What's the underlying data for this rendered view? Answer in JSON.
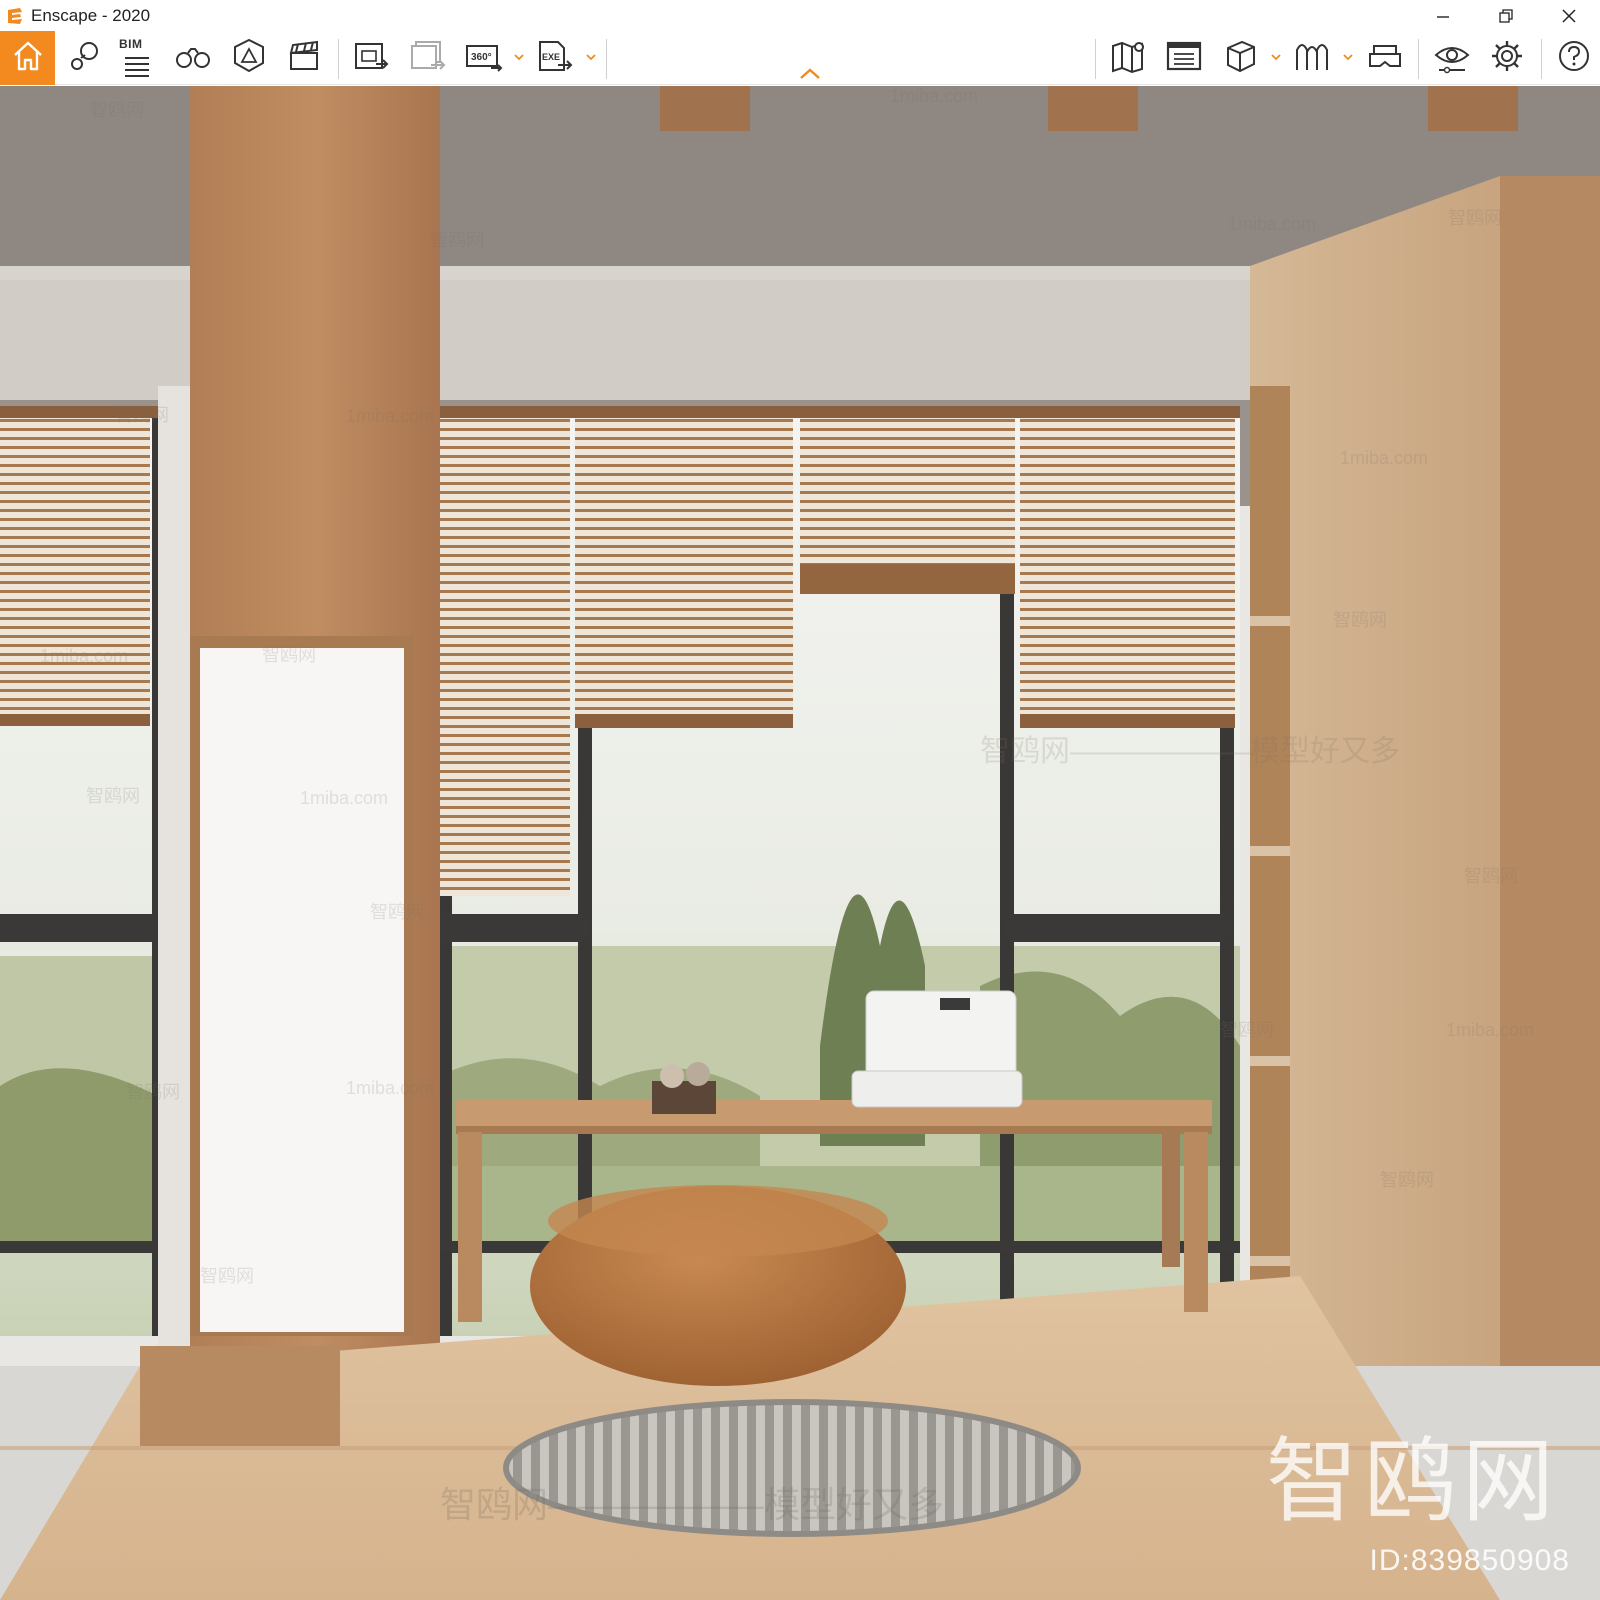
{
  "window": {
    "title": "Enscape - 2020",
    "controls": [
      "minimize",
      "restore",
      "close"
    ]
  },
  "toolbar": {
    "accent_color": "#f28a1f",
    "bim_label": "BIM",
    "groups": [
      [
        "home-icon",
        "pin-compass-icon",
        "bim-info-icon",
        "binoculars-icon",
        "warning-shield-icon",
        "clapperboard-icon"
      ],
      [
        "export-image-icon",
        "batch-export-icon",
        "export-360-icon",
        "export-exe-icon"
      ],
      [
        "map-icon",
        "asset-library-icon",
        "cube-view-icon",
        "book-library-icon",
        "vr-headset-icon"
      ],
      [
        "visual-settings-eye-icon",
        "gear-icon"
      ],
      [
        "help-icon"
      ]
    ]
  },
  "viewport": {
    "watermark_brand": "智鸥网",
    "watermark_domain": "1miba.com",
    "watermark_slogan": "智鸥网——————模型好又多",
    "watermark_id": "ID:839850908"
  }
}
